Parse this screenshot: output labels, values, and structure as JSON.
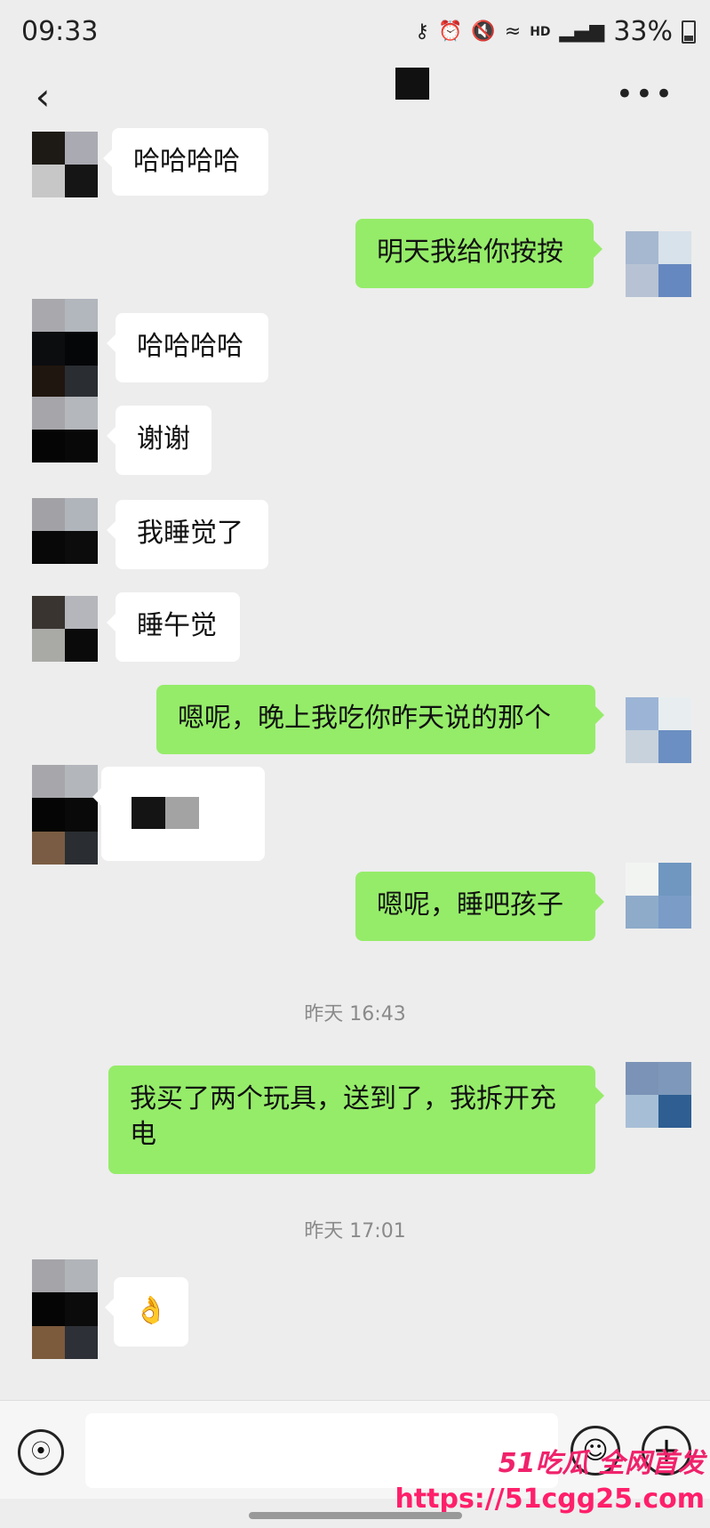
{
  "status_bar": {
    "time": "09:33",
    "icons": [
      "key-icon",
      "alarm-icon",
      "mute-icon",
      "wifi-icon",
      "hd-icon",
      "signal-icon"
    ],
    "hd_label": "HD",
    "battery_percent": "33%"
  },
  "nav": {
    "back_glyph": "‹",
    "more_glyph": "•••"
  },
  "messages": [
    {
      "side": "left",
      "text": "哈哈哈哈"
    },
    {
      "side": "right",
      "text": "明天我给你按按"
    },
    {
      "side": "left",
      "text": "哈哈哈哈"
    },
    {
      "side": "left",
      "text": "谢谢"
    },
    {
      "side": "left",
      "text": "我睡觉了"
    },
    {
      "side": "left",
      "text": "睡午觉"
    },
    {
      "side": "right",
      "text": "嗯呢，晚上我吃你昨天说的那个"
    },
    {
      "side": "left",
      "text": ""
    },
    {
      "side": "right",
      "text": "嗯呢，睡吧孩子"
    },
    {
      "side": "right",
      "text": "我买了两个玩具，送到了，我拆开充电"
    },
    {
      "side": "left",
      "text": "👌"
    }
  ],
  "timestamps": [
    "昨天 16:43",
    "昨天 17:01"
  ],
  "input_bar": {
    "voice_glyph": "⦿",
    "emoji_glyph": "☺",
    "plus_glyph": "+"
  },
  "watermark": {
    "top": "51吃瓜 全网首发",
    "url": "https://51cgg25.com"
  },
  "colors": {
    "background": "#ededed",
    "bubble_self": "#95ec69",
    "bubble_other": "#ffffff",
    "watermark": "#f0226b"
  }
}
